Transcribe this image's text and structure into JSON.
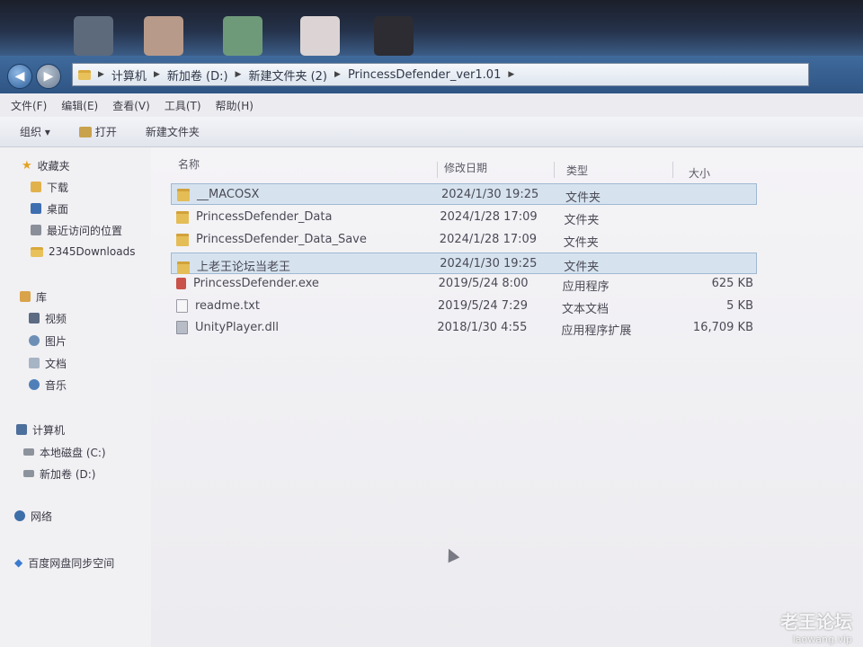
{
  "address": {
    "crumbs": [
      "计算机",
      "新加卷 (D:)",
      "新建文件夹 (2)",
      "PrincessDefender_ver1.01"
    ]
  },
  "menu": [
    "文件(F)",
    "编辑(E)",
    "查看(V)",
    "工具(T)",
    "帮助(H)"
  ],
  "toolbar": {
    "organize": "组织 ▾",
    "open": "打开",
    "new_folder": "新建文件夹"
  },
  "nav": {
    "favorites": "收藏夹",
    "downloads": "下载",
    "desktop": "桌面",
    "recent": "最近访问的位置",
    "downloads_2345": "2345Downloads",
    "libraries": "库",
    "videos": "视频",
    "pictures": "图片",
    "documents": "文档",
    "music": "音乐",
    "computer": "计算机",
    "local_disk": "本地磁盘 (C:)",
    "new_volume": "新加卷 (D:)",
    "network": "网络",
    "baidu": "百度网盘同步空间"
  },
  "columns": {
    "name": "名称",
    "date": "修改日期",
    "type": "类型",
    "size": "大小"
  },
  "files": [
    {
      "name": "__MACOSX",
      "date": "2024/1/30 19:25",
      "type": "文件夹",
      "size": "",
      "kind": "folder"
    },
    {
      "name": "PrincessDefender_Data",
      "date": "2024/1/28 17:09",
      "type": "文件夹",
      "size": "",
      "kind": "folder"
    },
    {
      "name": "PrincessDefender_Data_Save",
      "date": "2024/1/28 17:09",
      "type": "文件夹",
      "size": "",
      "kind": "folder"
    },
    {
      "name": "上老王论坛当老王",
      "date": "2024/1/30 19:25",
      "type": "文件夹",
      "size": "",
      "kind": "folder"
    },
    {
      "name": "PrincessDefender.exe",
      "date": "2019/5/24 8:00",
      "type": "应用程序",
      "size": "625 KB",
      "kind": "exe"
    },
    {
      "name": "readme.txt",
      "date": "2019/5/24 7:29",
      "type": "文本文档",
      "size": "5 KB",
      "kind": "txt"
    },
    {
      "name": "UnityPlayer.dll",
      "date": "2018/1/30 4:55",
      "type": "应用程序扩展",
      "size": "16,709 KB",
      "kind": "dll"
    }
  ],
  "watermark": {
    "title": "老王论坛",
    "url": "laowang.vip"
  }
}
